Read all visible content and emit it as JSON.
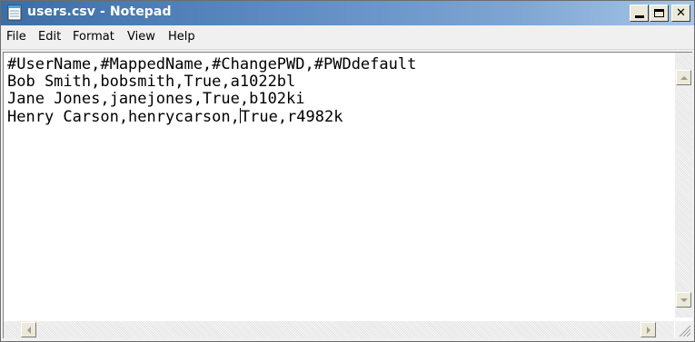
{
  "window": {
    "title": "users.csv - Notepad",
    "colors": {
      "title_bar_start": "#3b6ea5",
      "title_bar_end": "#a6c6e8",
      "title_text": "#ffffff",
      "menu_bg": "#f0f0f0"
    },
    "icon": "notepad-icon",
    "caption_buttons": [
      "minimize-icon",
      "maximize-icon",
      "close-icon"
    ],
    "close_glyph": "✕"
  },
  "menu": {
    "items": [
      "File",
      "Edit",
      "Format",
      "View",
      "Help"
    ]
  },
  "editor": {
    "lines": [
      "#UserName,#MappedName,#ChangePWD,#PWDdefault",
      "Bob Smith,bobsmith,True,a1022bl",
      "Jane Jones,janejones,True,b102ki",
      "Henry Carson,henrycarson,True,r4982k"
    ],
    "caret": {
      "line": 4,
      "before": "Henry Carson,henrycarson,",
      "after": "True,r4982k"
    }
  },
  "scrollbars": {
    "vertical_icons": [
      "scroll-up-icon",
      "scroll-down-icon"
    ],
    "horizontal_icons": [
      "scroll-left-icon",
      "scroll-right-icon"
    ]
  }
}
